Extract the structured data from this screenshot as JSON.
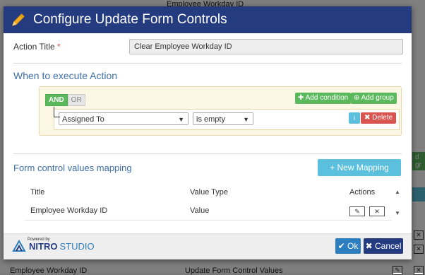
{
  "background": {
    "top_text": "Employee Workday ID",
    "bottom_left_text": "Employee Workday ID",
    "bottom_mid_text": "Update Form Control Values",
    "right_green_text": "d gr"
  },
  "dialog": {
    "title": "Configure Update Form Controls",
    "action_title_label": "Action Title",
    "required_mark": "*",
    "action_title_value": "Clear Employee Workday ID",
    "when_section_title": "When to execute Action",
    "query": {
      "and_label": "AND",
      "or_label": "OR",
      "add_condition_label": "Add condition",
      "add_group_label": "Add group",
      "field_value": "Assigned To",
      "operator_value": "is empty",
      "info_label": "i",
      "delete_label": "Delete"
    },
    "mapping_section_title": "Form control values mapping",
    "new_mapping_label": "+ New Mapping",
    "table": {
      "headers": [
        "Title",
        "Value Type",
        "Actions"
      ],
      "rows": [
        {
          "title": "Employee Workday ID",
          "value_type": "Value"
        }
      ]
    },
    "footer": {
      "powered_by": "Powered by",
      "brand_1": "NITRO",
      "brand_2": "STUDIO",
      "ok_label": "Ok",
      "cancel_label": "Cancel"
    }
  },
  "colors": {
    "header_bg": "#253b80",
    "section_title": "#3e6fa8",
    "green": "#5cb85c",
    "info": "#5bc0de",
    "danger": "#d9534f"
  }
}
